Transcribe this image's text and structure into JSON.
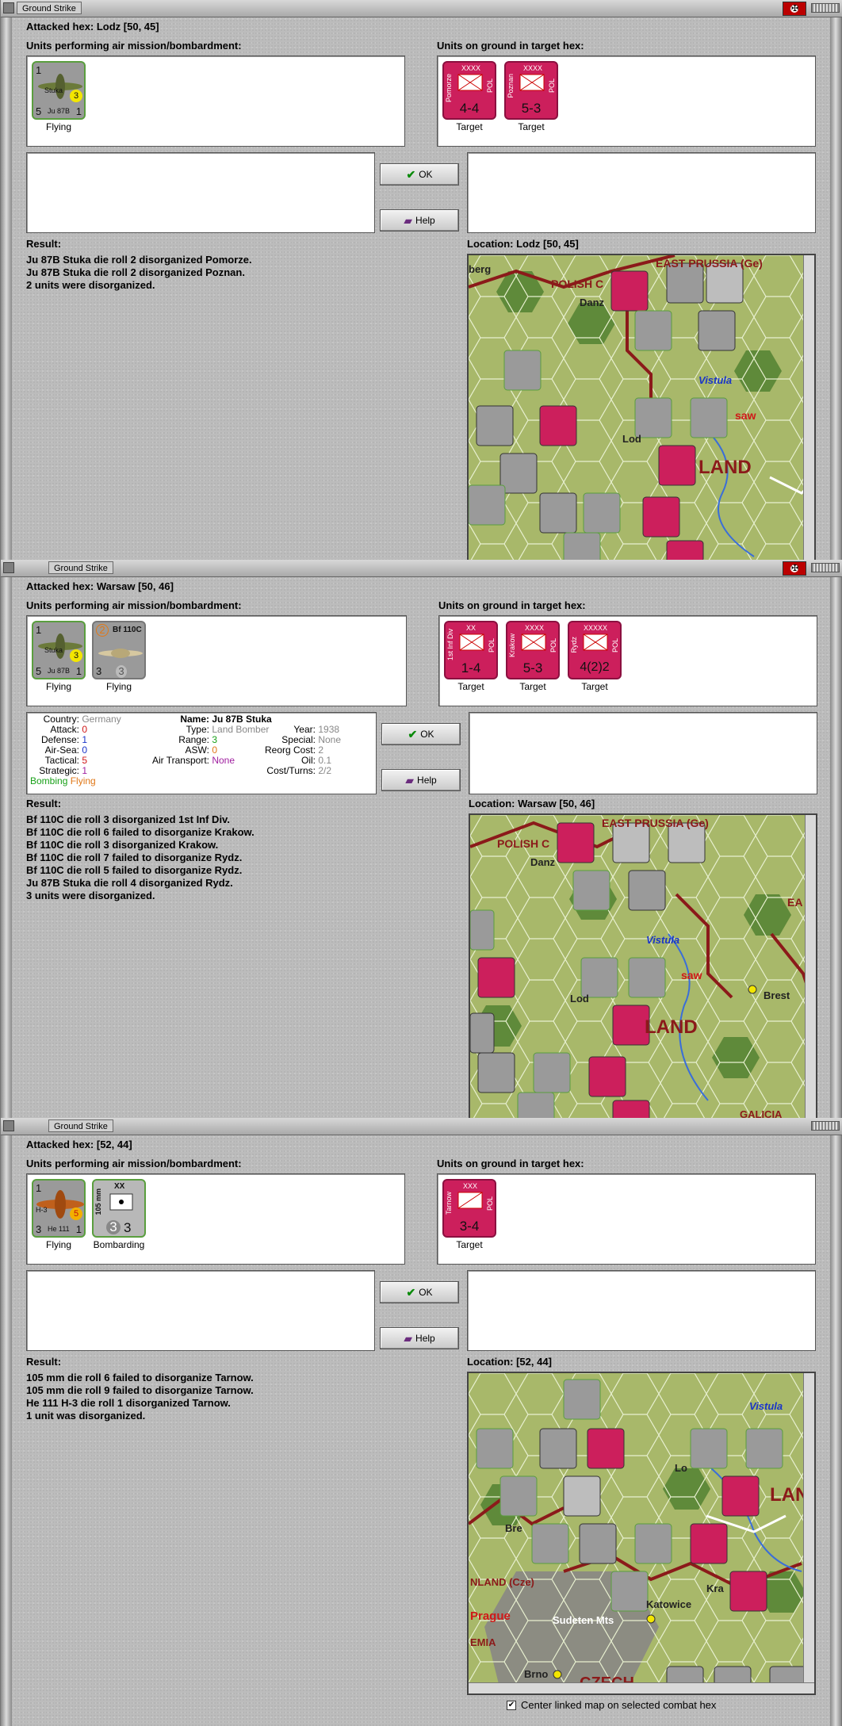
{
  "dialogs": [
    {
      "window_title": "Ground Strike",
      "attacked_hex": "Attacked hex: Lodz  [50, 45]",
      "air_units_header": "Units performing air mission/bombardment:",
      "ground_units_header": "Units on ground in target hex:",
      "air_units": [
        {
          "name": "Stuka",
          "model": "Ju 87B",
          "status": "Flying",
          "val_tl": "1",
          "val_bl": "5",
          "val_br": "1",
          "badge": "3"
        }
      ],
      "ground_units": [
        {
          "name": "Pomorze",
          "size": "XXXX",
          "nation": "POL",
          "strength": "4-4",
          "status": "Target"
        },
        {
          "name": "Poznan",
          "size": "XXXX",
          "nation": "POL",
          "strength": "5-3",
          "status": "Target"
        }
      ],
      "ok_label": "OK",
      "help_label": "Help",
      "result_label": "Result:",
      "result_lines": [
        "Ju 87B Stuka die roll 2 disorganized Pomorze.",
        "Ju 87B Stuka die roll 2 disorganized Poznan.",
        "2 units were disorganized."
      ],
      "location": "Location:  Lodz  [50, 45]",
      "map_labels": [
        "POLISH C",
        "EAST PRUSSIA (Ge)",
        "Danz",
        "Vistula",
        "saw",
        "Lod",
        "LAND",
        "berg"
      ]
    },
    {
      "window_title": "Ground Strike",
      "attacked_hex": "Attacked hex: Warsaw  [50, 46]",
      "air_units_header": "Units performing air mission/bombardment:",
      "ground_units_header": "Units on ground in target hex:",
      "air_units": [
        {
          "name": "Stuka",
          "model": "Ju 87B",
          "status": "Flying",
          "val_tl": "1",
          "val_bl": "5",
          "val_br": "1",
          "badge": "3"
        },
        {
          "name": "Bf 110C",
          "model": "",
          "status": "Flying",
          "val_tl": "2",
          "val_bl": "3",
          "val_br": "3",
          "badge": ""
        }
      ],
      "ground_units": [
        {
          "name": "1st Inf Div",
          "size": "XX",
          "nation": "POL",
          "strength": "1-4",
          "status": "Target"
        },
        {
          "name": "Krakow",
          "size": "XXXX",
          "nation": "POL",
          "strength": "5-3",
          "status": "Target"
        },
        {
          "name": "Rydz",
          "size": "XXXXX",
          "nation": "POL",
          "strength": "4(2)2",
          "status": "Target"
        }
      ],
      "unit_info": {
        "country_k": "Country:",
        "country_v": "Germany",
        "attack_k": "Attack:",
        "attack_v": "0",
        "defense_k": "Defense:",
        "defense_v": "1",
        "airsea_k": "Air-Sea:",
        "airsea_v": "0",
        "tactical_k": "Tactical:",
        "tactical_v": "5",
        "strategic_k": "Strategic:",
        "strategic_v": "1",
        "bombing": "Bombing",
        "flying": "Flying",
        "name_k": "Name:",
        "name_v": "Ju 87B Stuka",
        "type_k": "Type:",
        "type_v": "Land Bomber",
        "year_k": "Year:",
        "year_v": "1938",
        "range_k": "Range:",
        "range_v": "3",
        "special_k": "Special:",
        "special_v": "None",
        "asw_k": "ASW:",
        "asw_v": "0",
        "reorg_k": "Reorg Cost:",
        "reorg_v": "2",
        "airtrans_k": "Air Transport:",
        "airtrans_v": "None",
        "oil_k": "Oil:",
        "oil_v": "0.1",
        "cost_k": "Cost/Turns:",
        "cost_v": "2/2"
      },
      "ok_label": "OK",
      "help_label": "Help",
      "result_label": "Result:",
      "result_lines": [
        "Bf 110C die roll 3 disorganized 1st Inf Div.",
        "Bf 110C die roll 6 failed to disorganize Krakow.",
        "Bf 110C die roll 3 disorganized Krakow.",
        "Bf 110C die roll 7 failed to disorganize Rydz.",
        "Bf 110C die roll 5 failed to disorganize Rydz.",
        "Ju 87B Stuka die roll 4 disorganized Rydz.",
        "3 units were disorganized."
      ],
      "location": "Location:  Warsaw  [50, 46]",
      "map_labels": [
        "POLISH C",
        "EAST PRUSSIA (Ge)",
        "Danz",
        "Vistula",
        "saw",
        "Lod",
        "LAND",
        "Brest",
        "EA",
        "GALICIA"
      ]
    },
    {
      "window_title": "Ground Strike",
      "attacked_hex": "Attacked hex:  [52, 44]",
      "air_units_header": "Units performing air mission/bombardment:",
      "ground_units_header": "Units on ground in target hex:",
      "air_units": [
        {
          "name": "H-3",
          "model": "He 111",
          "status": "Flying",
          "val_tl": "1",
          "val_bl": "3",
          "val_br": "1",
          "badge": "5"
        },
        {
          "name": "105 mm",
          "model": "",
          "status": "Bombarding",
          "val_tl": "XX",
          "val_bl": "3",
          "val_br": "3",
          "badge": ""
        }
      ],
      "ground_units": [
        {
          "name": "Tarnow",
          "size": "XXX",
          "nation": "POL",
          "strength": "3-4",
          "status": "Target"
        }
      ],
      "ok_label": "OK",
      "help_label": "Help",
      "result_label": "Result:",
      "result_lines": [
        "105 mm die roll 6 failed to disorganize Tarnow.",
        "105 mm die roll 9 failed to disorganize Tarnow.",
        "He 111 H-3 die roll 1 disorganized Tarnow.",
        "1 unit was disorganized."
      ],
      "location": "Location:  [52, 44]",
      "map_labels": [
        "Vistula",
        "Lo",
        "LAN",
        "Bre",
        "NLAND (Cze)",
        "Prague",
        "Sudeten Mts",
        "Katowice",
        "Kra",
        "Brno",
        "CZECH",
        "EMIA"
      ]
    }
  ],
  "center_checkbox": {
    "label": "Center linked map on selected combat hex",
    "checked": true
  }
}
